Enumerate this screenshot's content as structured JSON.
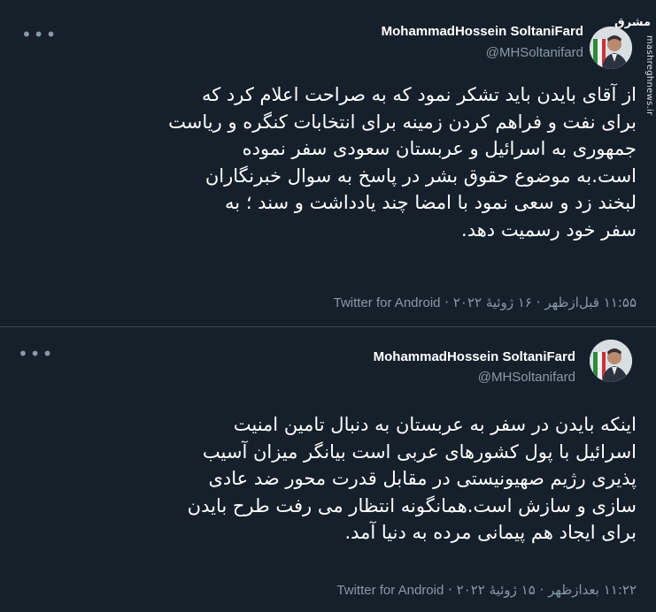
{
  "watermark": {
    "logo_text": "مشرق",
    "site": "mashreghnews.ir"
  },
  "tweets": [
    {
      "author": "MohammadHossein SoltaniFard",
      "handle": "@MHSoltanifard",
      "text": "از آقای بایدن باید تشکر نمود که به صراحت اعلام کرد که\nبرای نفت و فراهم کردن زمینه برای انتخابات کنگره و ریاست\nجمهوری به اسرائیل و عربستان سعودی سفر نموده\nاست.به موضوع حقوق بشر در پاسخ به سوال خبرنگاران\nلبخند زد و سعی نمود با امضا چند یادداشت و سند ؛ به\nسفر خود رسمیت دهد.",
      "time": "۱۱:۵۵ قبل‌ازظهر",
      "date": "۱۶ ژوئیهٔ ۲۰۲۲",
      "source": "Twitter for Android",
      "more_icon": "more-horizontal-icon"
    },
    {
      "author": "MohammadHossein SoltaniFard",
      "handle": "@MHSoltanifard",
      "text": "اینکه بایدن در سفر به عربستان به دنبال تامین امنیت\nاسرائیل با پول کشورهای عربی است بیانگر میزان آسیب\nپذیری رژیم صهیونیستی در مقابل قدرت محور ضد عادی\nسازی و سازش است.همانگونه انتظار می رفت طرح بایدن\nبرای ایجاد هم پیمانی مرده به دنیا آمد.",
      "time": "۱۱:۲۲ بعدازظهر",
      "date": "۱۵ ژوئیهٔ ۲۰۲۲",
      "source": "Twitter for Android",
      "more_icon": "more-horizontal-icon"
    }
  ],
  "separator": "·",
  "colors": {
    "background": "#15202b",
    "text": "#ffffff",
    "secondary": "#8899a6",
    "divider": "#38444d"
  }
}
